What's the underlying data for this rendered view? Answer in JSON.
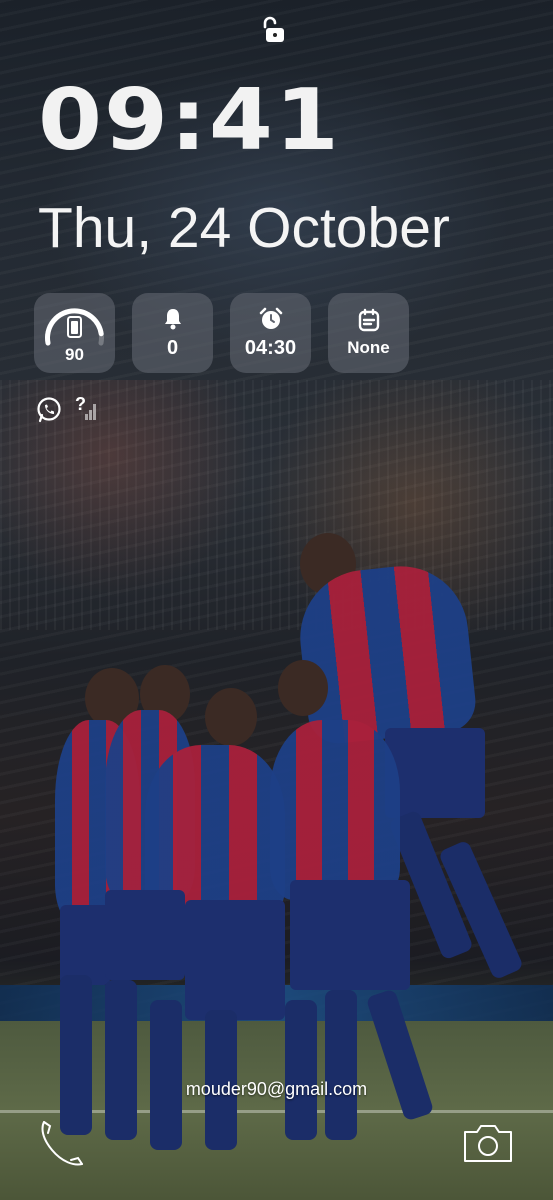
{
  "status": {
    "lock_state": "unlocked-lock-icon"
  },
  "clock": {
    "time": "09:41"
  },
  "date": {
    "label": "Thu, 24 October"
  },
  "widgets": {
    "battery": {
      "icon": "battery-gauge-icon",
      "value": "90",
      "level_percent": 90
    },
    "notifications": {
      "icon": "bell-icon",
      "value": "0"
    },
    "alarm": {
      "icon": "alarm-clock-icon",
      "value": "04:30"
    },
    "calendar": {
      "icon": "calendar-icon",
      "value": "None"
    }
  },
  "notification_icons": [
    {
      "icon": "whatsapp-icon"
    },
    {
      "icon": "no-signal-icon",
      "text": "?"
    }
  ],
  "owner_info": {
    "email": "mouder90@gmail.com"
  },
  "shortcuts": {
    "left": "phone-icon",
    "right": "camera-icon"
  },
  "colors": {
    "widget_bg": "#5f646e",
    "text": "#ffffff"
  }
}
